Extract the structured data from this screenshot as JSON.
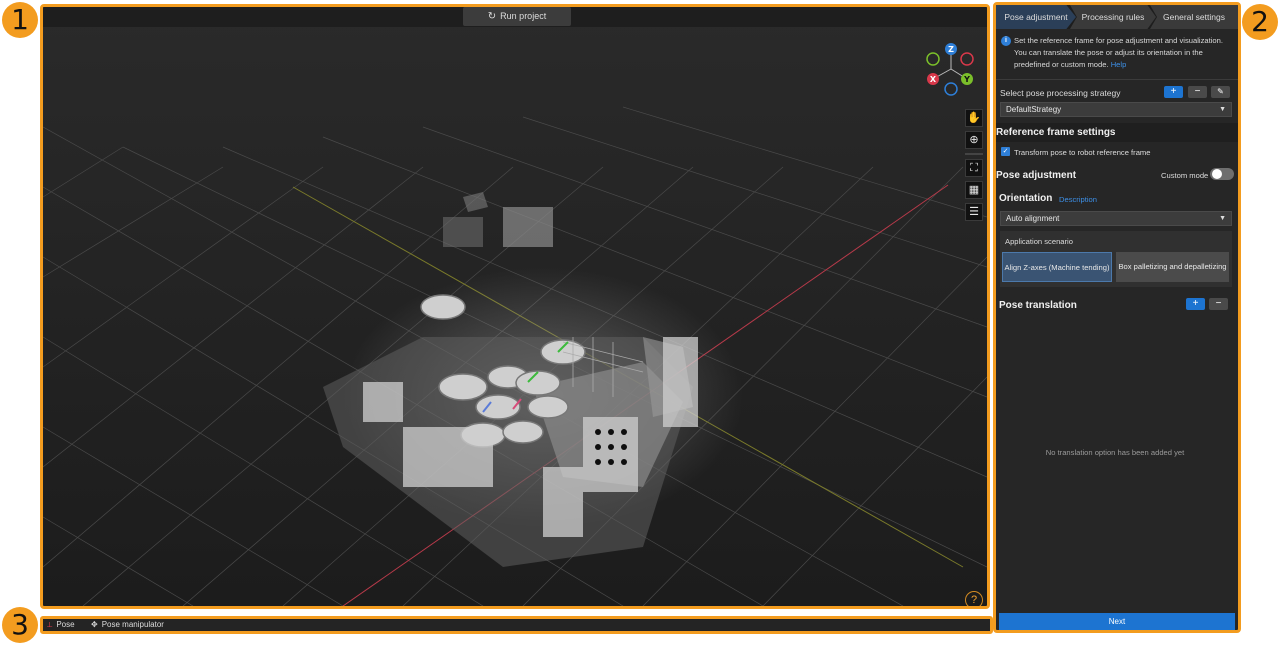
{
  "callouts": [
    "1",
    "2",
    "3"
  ],
  "viewport": {
    "run_label": "Run project",
    "axes": {
      "z": "Z",
      "x": "X",
      "y": "Y"
    },
    "tools": [
      "pan-hand-icon",
      "zoom-icon",
      "fit-view-icon",
      "grid-view-icon",
      "list-view-icon"
    ],
    "help_label": "?"
  },
  "panel": {
    "tabs": [
      "Pose adjustment",
      "Processing rules",
      "General settings"
    ],
    "info_text": "Set the reference frame for pose adjustment and visualization. You can translate the pose or adjust its orientation in the predefined or custom mode.",
    "info_link": "Help",
    "strategy_label": "Select pose processing strategy",
    "strategy_value": "DefaultStrategy",
    "ref_frame_title": "Reference frame settings",
    "transform_label": "Transform pose to robot reference frame",
    "pose_adjustment_title": "Pose adjustment",
    "custom_mode_label": "Custom mode",
    "orientation_title": "Orientation",
    "orientation_link": "Description",
    "orientation_value": "Auto alignment",
    "scenario_label": "Application scenario",
    "scenario_options": [
      "Align Z-axes (Machine tending)",
      "Box palletizing and depalletizing"
    ],
    "translation_title": "Pose translation",
    "empty_message": "No translation option has been added yet",
    "next_label": "Next",
    "btn_add": "+",
    "btn_remove": "−",
    "btn_edit": "✎",
    "check_mark": "✓",
    "info_icon_text": "i",
    "caret": "▼"
  },
  "bottom": {
    "items": [
      "Pose",
      "Pose manipulator"
    ]
  },
  "colors": {
    "accent": "#f39c1f",
    "primary_button": "#1d74d1",
    "axis_z": "#2e7fd8",
    "axis_x": "#d8384a",
    "axis_y": "#7bbf2a"
  }
}
